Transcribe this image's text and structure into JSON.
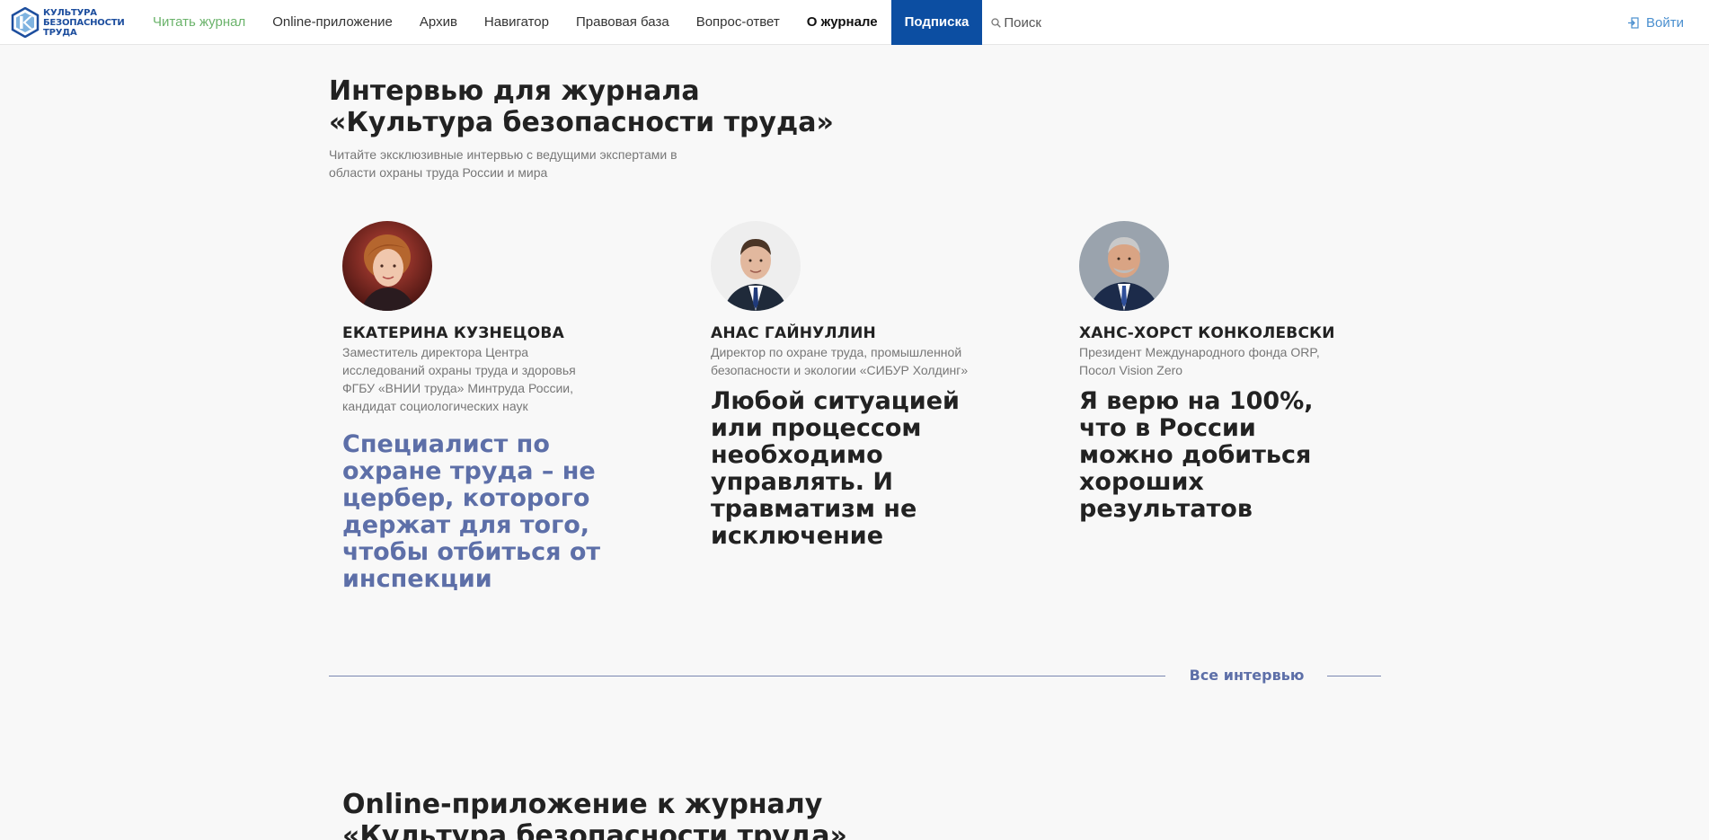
{
  "brand": {
    "logo_lines": [
      "КУЛЬТУРА",
      "БЕЗОПАСНОСТИ",
      "ТРУДА"
    ],
    "logo_letter": "К",
    "accent_color": "#0c4ea2"
  },
  "nav": {
    "items": [
      {
        "label": "Читать журнал",
        "state": "current"
      },
      {
        "label": "Online-приложение"
      },
      {
        "label": "Архив"
      },
      {
        "label": "Навигатор"
      },
      {
        "label": "Правовая база"
      },
      {
        "label": "Вопрос-ответ"
      },
      {
        "label": "О журнале",
        "state": "bold"
      },
      {
        "label": "Подписка",
        "state": "highlight"
      }
    ],
    "search_label": "Поиск",
    "search_icon": "search-icon",
    "login_label": "Войти",
    "login_icon": "login-icon"
  },
  "interviews": {
    "title": "Интервью для журнала «Культура безопасности труда»",
    "subtitle": "Читайте эксклюзивные интервью с ведущими экспертами в области охраны труда России и мира",
    "cards": [
      {
        "name": "Екатерина Кузнецова",
        "role": "Заместитель директора Центра исследований охраны труда и здоровья ФГБУ «ВНИИ труда» Минтруда России, кандидат социологических наук",
        "quote": "Специалист по охране труда – не цербер, которого держат для того, чтобы отбиться от инспекции",
        "quote_color": "#5d6fa8"
      },
      {
        "name": "Анас Гайнуллин",
        "role": "Директор по охране труда, промышленной безопасности и экологии «СИБУР Холдинг»",
        "quote": "Любой ситуацией или процессом необходимо управлять. И травматизм не исключение",
        "quote_color": "#222222"
      },
      {
        "name": "Ханс-Хорст Конколевски",
        "role": "Президент Международного фонда ORP, Посол Vision Zero",
        "quote": "Я верю на 100%, что в России можно добиться хороших результатов",
        "quote_color": "#222222"
      }
    ],
    "all_link": "Все интервью"
  },
  "online_app": {
    "title": "Online-приложение к журналу «Культура безопасности труда»"
  }
}
